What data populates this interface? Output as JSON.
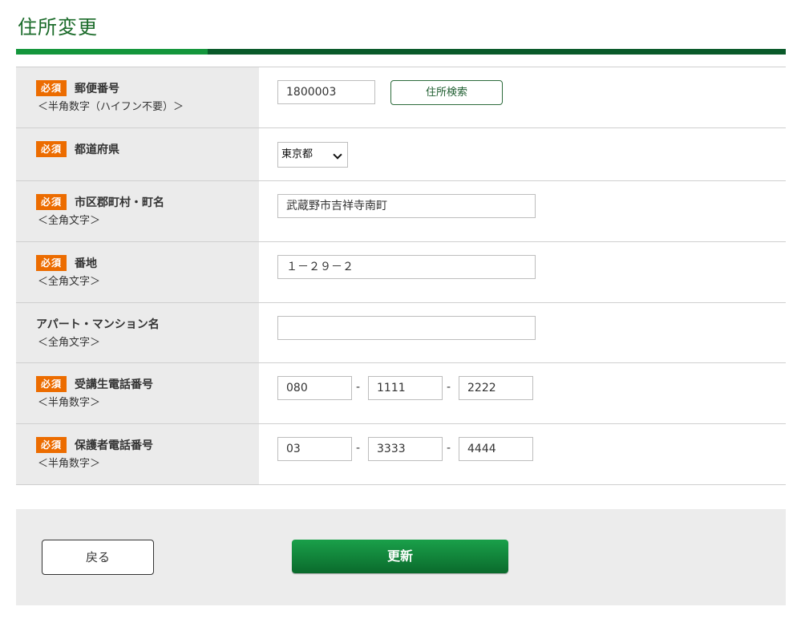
{
  "page_title": "住所変更",
  "required_badge": "必須",
  "fields": {
    "postal": {
      "label": "郵便番号",
      "note": "＜半角数字（ハイフン不要）＞",
      "value": "1800003",
      "search_label": "住所検索"
    },
    "prefecture": {
      "label": "都道府県",
      "value": "東京都"
    },
    "city": {
      "label": "市区郡町村・町名",
      "note": "＜全角文字＞",
      "value": "武蔵野市吉祥寺南町"
    },
    "block": {
      "label": "番地",
      "note": "＜全角文字＞",
      "value": "１－２９－２"
    },
    "building": {
      "label": "アパート・マンション名",
      "note": "＜全角文字＞",
      "value": ""
    },
    "student_phone": {
      "label": "受講生電話番号",
      "note": "＜半角数字＞",
      "part1": "080",
      "part2": "1111",
      "part3": "2222"
    },
    "guardian_phone": {
      "label": "保護者電話番号",
      "note": "＜半角数字＞",
      "part1": "03",
      "part2": "3333",
      "part3": "4444"
    }
  },
  "separator": "-",
  "buttons": {
    "back": "戻る",
    "update": "更新"
  },
  "colors": {
    "title": "#1b6b2a",
    "title_bar": "#0a5a2a",
    "title_bar_accent": "#14963c",
    "required_badge": "#ec6c00",
    "update_button": "#0f8a3a"
  },
  "icons": {
    "select_arrow": "chevron-down-icon"
  }
}
